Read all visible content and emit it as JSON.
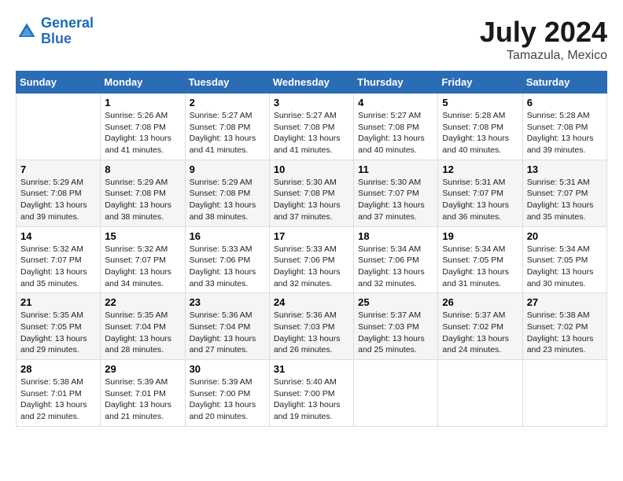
{
  "header": {
    "logo_line1": "General",
    "logo_line2": "Blue",
    "title": "July 2024",
    "subtitle": "Tamazula, Mexico"
  },
  "columns": [
    "Sunday",
    "Monday",
    "Tuesday",
    "Wednesday",
    "Thursday",
    "Friday",
    "Saturday"
  ],
  "weeks": [
    [
      {
        "day": "",
        "info": ""
      },
      {
        "day": "1",
        "info": "Sunrise: 5:26 AM\nSunset: 7:08 PM\nDaylight: 13 hours\nand 41 minutes."
      },
      {
        "day": "2",
        "info": "Sunrise: 5:27 AM\nSunset: 7:08 PM\nDaylight: 13 hours\nand 41 minutes."
      },
      {
        "day": "3",
        "info": "Sunrise: 5:27 AM\nSunset: 7:08 PM\nDaylight: 13 hours\nand 41 minutes."
      },
      {
        "day": "4",
        "info": "Sunrise: 5:27 AM\nSunset: 7:08 PM\nDaylight: 13 hours\nand 40 minutes."
      },
      {
        "day": "5",
        "info": "Sunrise: 5:28 AM\nSunset: 7:08 PM\nDaylight: 13 hours\nand 40 minutes."
      },
      {
        "day": "6",
        "info": "Sunrise: 5:28 AM\nSunset: 7:08 PM\nDaylight: 13 hours\nand 39 minutes."
      }
    ],
    [
      {
        "day": "7",
        "info": "Sunrise: 5:29 AM\nSunset: 7:08 PM\nDaylight: 13 hours\nand 39 minutes."
      },
      {
        "day": "8",
        "info": "Sunrise: 5:29 AM\nSunset: 7:08 PM\nDaylight: 13 hours\nand 38 minutes."
      },
      {
        "day": "9",
        "info": "Sunrise: 5:29 AM\nSunset: 7:08 PM\nDaylight: 13 hours\nand 38 minutes."
      },
      {
        "day": "10",
        "info": "Sunrise: 5:30 AM\nSunset: 7:08 PM\nDaylight: 13 hours\nand 37 minutes."
      },
      {
        "day": "11",
        "info": "Sunrise: 5:30 AM\nSunset: 7:07 PM\nDaylight: 13 hours\nand 37 minutes."
      },
      {
        "day": "12",
        "info": "Sunrise: 5:31 AM\nSunset: 7:07 PM\nDaylight: 13 hours\nand 36 minutes."
      },
      {
        "day": "13",
        "info": "Sunrise: 5:31 AM\nSunset: 7:07 PM\nDaylight: 13 hours\nand 35 minutes."
      }
    ],
    [
      {
        "day": "14",
        "info": "Sunrise: 5:32 AM\nSunset: 7:07 PM\nDaylight: 13 hours\nand 35 minutes."
      },
      {
        "day": "15",
        "info": "Sunrise: 5:32 AM\nSunset: 7:07 PM\nDaylight: 13 hours\nand 34 minutes."
      },
      {
        "day": "16",
        "info": "Sunrise: 5:33 AM\nSunset: 7:06 PM\nDaylight: 13 hours\nand 33 minutes."
      },
      {
        "day": "17",
        "info": "Sunrise: 5:33 AM\nSunset: 7:06 PM\nDaylight: 13 hours\nand 32 minutes."
      },
      {
        "day": "18",
        "info": "Sunrise: 5:34 AM\nSunset: 7:06 PM\nDaylight: 13 hours\nand 32 minutes."
      },
      {
        "day": "19",
        "info": "Sunrise: 5:34 AM\nSunset: 7:05 PM\nDaylight: 13 hours\nand 31 minutes."
      },
      {
        "day": "20",
        "info": "Sunrise: 5:34 AM\nSunset: 7:05 PM\nDaylight: 13 hours\nand 30 minutes."
      }
    ],
    [
      {
        "day": "21",
        "info": "Sunrise: 5:35 AM\nSunset: 7:05 PM\nDaylight: 13 hours\nand 29 minutes."
      },
      {
        "day": "22",
        "info": "Sunrise: 5:35 AM\nSunset: 7:04 PM\nDaylight: 13 hours\nand 28 minutes."
      },
      {
        "day": "23",
        "info": "Sunrise: 5:36 AM\nSunset: 7:04 PM\nDaylight: 13 hours\nand 27 minutes."
      },
      {
        "day": "24",
        "info": "Sunrise: 5:36 AM\nSunset: 7:03 PM\nDaylight: 13 hours\nand 26 minutes."
      },
      {
        "day": "25",
        "info": "Sunrise: 5:37 AM\nSunset: 7:03 PM\nDaylight: 13 hours\nand 25 minutes."
      },
      {
        "day": "26",
        "info": "Sunrise: 5:37 AM\nSunset: 7:02 PM\nDaylight: 13 hours\nand 24 minutes."
      },
      {
        "day": "27",
        "info": "Sunrise: 5:38 AM\nSunset: 7:02 PM\nDaylight: 13 hours\nand 23 minutes."
      }
    ],
    [
      {
        "day": "28",
        "info": "Sunrise: 5:38 AM\nSunset: 7:01 PM\nDaylight: 13 hours\nand 22 minutes."
      },
      {
        "day": "29",
        "info": "Sunrise: 5:39 AM\nSunset: 7:01 PM\nDaylight: 13 hours\nand 21 minutes."
      },
      {
        "day": "30",
        "info": "Sunrise: 5:39 AM\nSunset: 7:00 PM\nDaylight: 13 hours\nand 20 minutes."
      },
      {
        "day": "31",
        "info": "Sunrise: 5:40 AM\nSunset: 7:00 PM\nDaylight: 13 hours\nand 19 minutes."
      },
      {
        "day": "",
        "info": ""
      },
      {
        "day": "",
        "info": ""
      },
      {
        "day": "",
        "info": ""
      }
    ]
  ]
}
